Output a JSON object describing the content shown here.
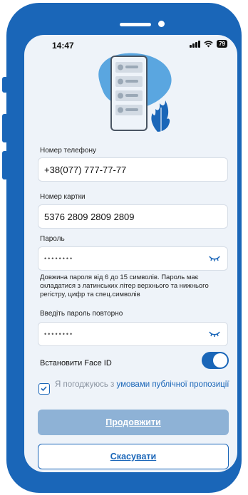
{
  "status_bar": {
    "time": "14:47",
    "battery": "79"
  },
  "form": {
    "phone": {
      "label": "Номер телефону",
      "value": "+38(077) 777-77-77"
    },
    "card": {
      "label": "Номер картки",
      "value": "5376 2809 2809 2809"
    },
    "password": {
      "label": "Пароль",
      "masked_value": "••••••••"
    },
    "password_hint": "Довжина пароля від 6 до 15 символів. Пароль має складатися з латинських літер верхнього та нижнього регістру, цифр та спец.символів",
    "password_repeat": {
      "label": "Введіть пароль повторно",
      "masked_value": "••••••••"
    }
  },
  "face_id": {
    "label": "Встановити Face ID",
    "enabled": true
  },
  "agreement": {
    "prefix": "Я погоджуюсь з ",
    "link": "умовами публічної пропозиції",
    "checked": true
  },
  "buttons": {
    "continue": "Продовжити",
    "cancel": "Скасувати"
  },
  "colors": {
    "brand": "#1a66b8",
    "primary_disabled": "#8eb2d6",
    "background": "#eef3f9"
  }
}
